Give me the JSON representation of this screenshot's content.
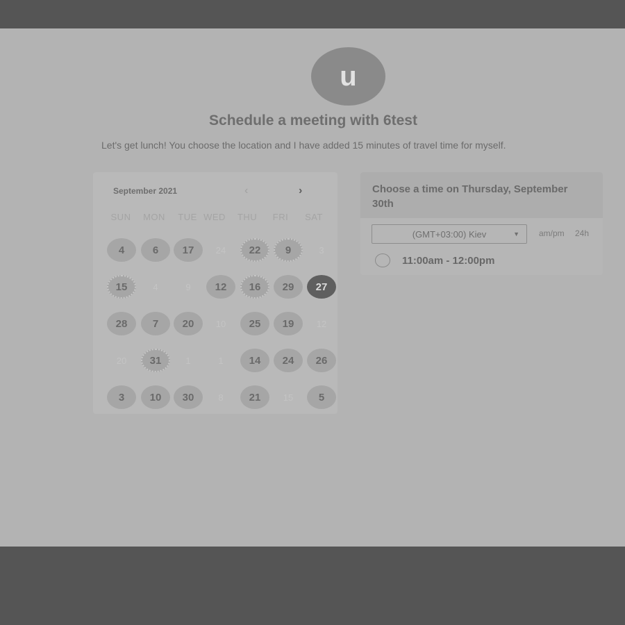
{
  "avatar_letter": "u",
  "title": "Schedule a meeting with 6test",
  "subtitle": "Let's get lunch! You choose the location and I have added 15 minutes of travel time for myself.",
  "calendar": {
    "month_label": "September 2021",
    "prev_icon": "‹",
    "next_icon": "›",
    "weekdays": [
      "SUN",
      "MON",
      "TUE",
      "WED",
      "THU",
      "FRI",
      "SAT"
    ],
    "days": [
      {
        "label": "4",
        "state": "avail"
      },
      {
        "label": "6",
        "state": "avail"
      },
      {
        "label": "17",
        "state": "avail"
      },
      {
        "label": "24",
        "state": "disabled"
      },
      {
        "label": "22",
        "state": "dotted"
      },
      {
        "label": "9",
        "state": "dotted"
      },
      {
        "label": "3",
        "state": "disabled"
      },
      {
        "label": "15",
        "state": "dotted"
      },
      {
        "label": "4",
        "state": "disabled"
      },
      {
        "label": "9",
        "state": "disabled"
      },
      {
        "label": "12",
        "state": "avail"
      },
      {
        "label": "16",
        "state": "dotted"
      },
      {
        "label": "29",
        "state": "avail"
      },
      {
        "label": "27",
        "state": "selected"
      },
      {
        "label": "28",
        "state": "avail"
      },
      {
        "label": "7",
        "state": "avail"
      },
      {
        "label": "20",
        "state": "avail"
      },
      {
        "label": "10",
        "state": "disabled"
      },
      {
        "label": "25",
        "state": "avail"
      },
      {
        "label": "19",
        "state": "avail"
      },
      {
        "label": "12",
        "state": "disabled"
      },
      {
        "label": "20",
        "state": "disabled"
      },
      {
        "label": "31",
        "state": "dotted"
      },
      {
        "label": "1",
        "state": "disabled"
      },
      {
        "label": "1",
        "state": "disabled"
      },
      {
        "label": "14",
        "state": "avail"
      },
      {
        "label": "24",
        "state": "avail"
      },
      {
        "label": "26",
        "state": "avail"
      },
      {
        "label": "3",
        "state": "avail"
      },
      {
        "label": "10",
        "state": "avail"
      },
      {
        "label": "30",
        "state": "avail"
      },
      {
        "label": "8",
        "state": "disabled"
      },
      {
        "label": "21",
        "state": "avail"
      },
      {
        "label": "15",
        "state": "disabled"
      },
      {
        "label": "5",
        "state": "avail"
      }
    ]
  },
  "time_panel": {
    "heading": "Choose a time on Thursday, September 30th",
    "timezone": "(GMT+03:00) Kiev",
    "format_ampm": "am/pm",
    "format_24h": "24h",
    "slots": [
      "11:00am - 12:00pm"
    ]
  }
}
